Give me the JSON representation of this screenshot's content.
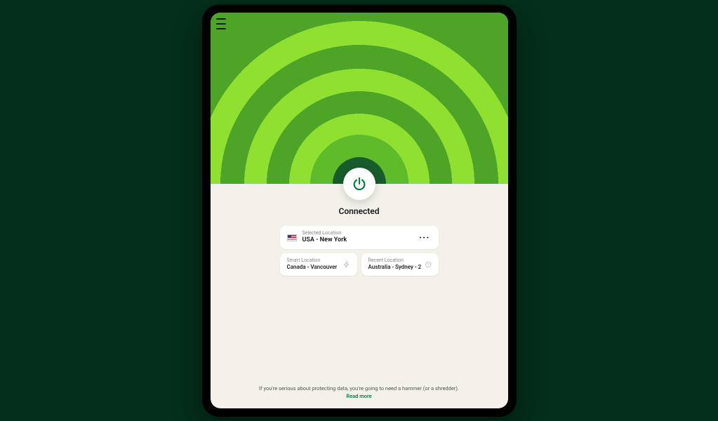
{
  "status": "Connected",
  "selected": {
    "label": "Selected Location",
    "value": "USA - New York",
    "flag": "us"
  },
  "smart": {
    "label": "Smart Location",
    "value": "Canada - Vancouver"
  },
  "recent": {
    "label": "Recent Location",
    "value": "Australia - Sydney - 2"
  },
  "footer": {
    "line": "If you're serious about protecting data, you're going to need a hammer (or a shredder).",
    "link": "Read more"
  },
  "icons": {
    "menu": "menu-icon",
    "power": "power-icon",
    "more": "more-icon",
    "bolt": "bolt-icon",
    "clock": "clock-icon"
  },
  "colors": {
    "accent_green": "#5fbb2a",
    "dark_green": "#185c2c",
    "bg_cream": "#f4f1ea",
    "link_green": "#0a7d4a"
  }
}
